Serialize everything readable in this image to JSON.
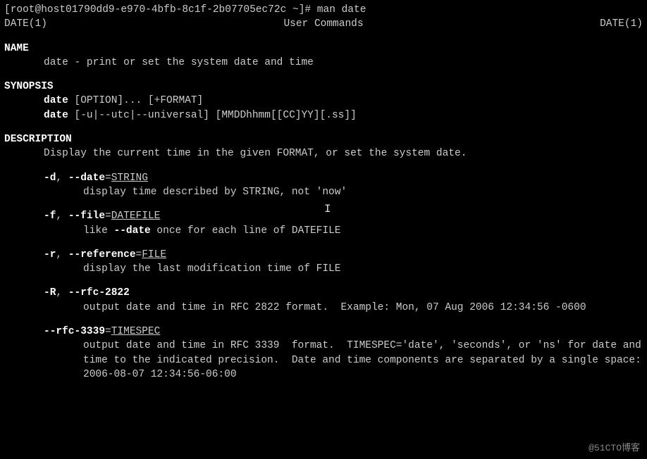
{
  "prompt": {
    "user": "root",
    "host": "host01790dd9-e970-4bfb-8c1f-2b07705ec72c",
    "cwd": "~",
    "command": "man date"
  },
  "man_header": {
    "left": "DATE(1)",
    "center": "User Commands",
    "right": "DATE(1)"
  },
  "sections": {
    "name": {
      "title": "NAME",
      "text": "date - print or set the system date and time"
    },
    "synopsis": {
      "title": "SYNOPSIS",
      "line1_cmd": "date",
      "line1_rest": " [OPTION]... [+FORMAT]",
      "line2_cmd": "date",
      "line2_rest": " [-u|--utc|--universal] [MMDDhhmm[[CC]YY][.ss]]"
    },
    "description": {
      "title": "DESCRIPTION",
      "intro": "Display the current time in the given FORMAT, or set the system date.",
      "options": [
        {
          "short": "-d",
          "long": "--date",
          "arg": "STRING",
          "desc_pre": "display time described by STRING, not ",
          "desc_quoted": "'now'"
        },
        {
          "short": "-f",
          "long": "--file",
          "arg": "DATEFILE",
          "desc_pre": "like ",
          "desc_bold": "--date",
          "desc_post": " once for each line of DATEFILE"
        },
        {
          "short": "-r",
          "long": "--reference",
          "arg": "FILE",
          "desc_pre": "display the last modification time of FILE"
        },
        {
          "short": "-R",
          "long": "--rfc-2822",
          "arg": "",
          "desc_pre": "output date and time in RFC 2822 format.  Example: Mon, 07 Aug 2006 12:34:56 -0600"
        },
        {
          "short": "",
          "long": "--rfc-3339",
          "arg": "TIMESPEC",
          "desc_pre": "output date and time in RFC 3339  format.  TIMESPEC='date', 'seconds', or 'ns' for date and time to the indicated precision.  Date and time components are separated by a single space: 2006-08-07 12:34:56-06:00"
        }
      ]
    }
  },
  "cursor_glyph": "I",
  "watermark": "@51CTO博客"
}
